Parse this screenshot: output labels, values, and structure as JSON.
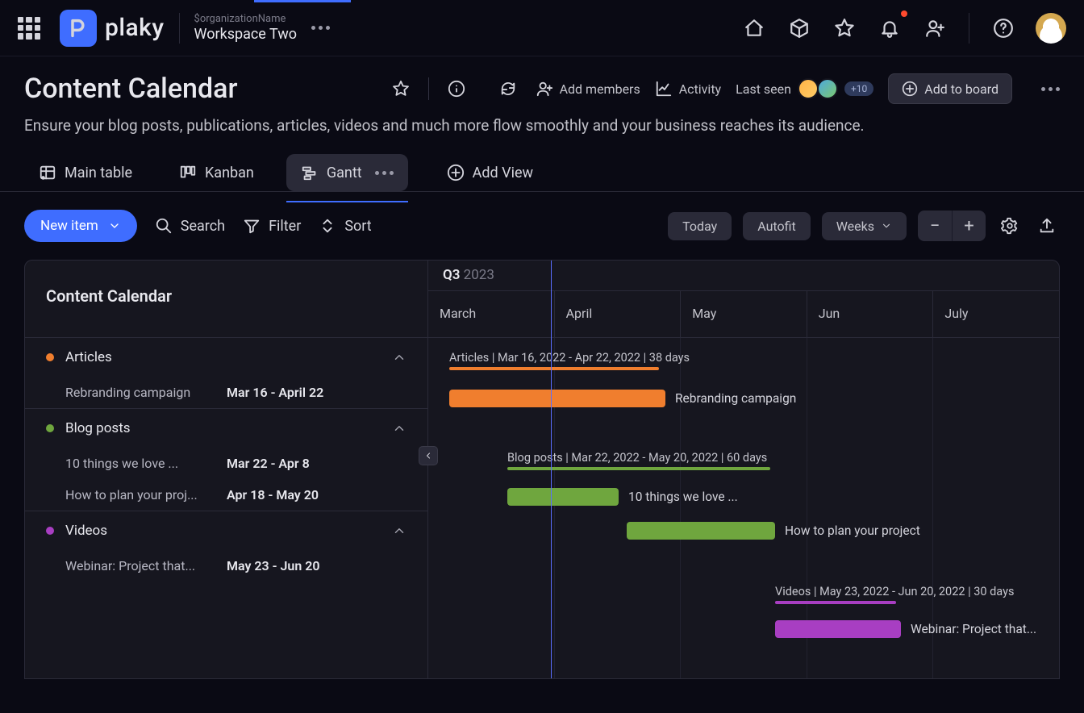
{
  "org": {
    "label": "$organizationName",
    "workspace": "Workspace Two"
  },
  "board": {
    "title": "Content Calendar",
    "description": "Ensure your blog posts, publications, articles, videos and much more flow smoothly and your business reaches its audience.",
    "add_members": "Add members",
    "activity": "Activity",
    "last_seen": "Last seen",
    "overflow_count": "+10",
    "add_to_board": "Add to board"
  },
  "views": {
    "main_table": "Main table",
    "kanban": "Kanban",
    "gantt": "Gantt",
    "add_view": "Add View"
  },
  "toolbar": {
    "new_item": "New item",
    "search": "Search",
    "filter": "Filter",
    "sort": "Sort",
    "today": "Today",
    "autofit": "Autofit",
    "timescale": "Weeks"
  },
  "gantt": {
    "side_title": "Content Calendar",
    "quarter_q": "Q3",
    "quarter_y": "2023",
    "months": [
      "March",
      "April",
      "May",
      "Jun",
      "July"
    ],
    "groups": [
      {
        "name": "Articles",
        "color": "#f07e2e",
        "summary": "Articles | Mar 16, 2022 - Apr 22, 2022 | 38 days",
        "tasks": [
          {
            "name": "Rebranding campaign",
            "dates": "Mar 16 - April 22",
            "bar_label": "Rebranding campaign"
          }
        ]
      },
      {
        "name": "Blog posts",
        "color": "#6fa63e",
        "summary": "Blog posts | Mar 22, 2022 - May 20, 2022 | 60 days",
        "tasks": [
          {
            "name": "10 things we love ...",
            "dates": "Mar 22 - Apr 8",
            "bar_label": "10 things we love ..."
          },
          {
            "name": "How to plan your proj...",
            "dates": "Apr 18 - May 20",
            "bar_label": "How to plan your project"
          }
        ]
      },
      {
        "name": "Videos",
        "color": "#a83ec2",
        "summary": "Videos | May 23, 2022 - Jun 20, 2022 | 30 days",
        "tasks": [
          {
            "name": "Webinar: Project that...",
            "dates": "May 23 - Jun 20",
            "bar_label": "Webinar: Project that..."
          }
        ]
      }
    ]
  }
}
